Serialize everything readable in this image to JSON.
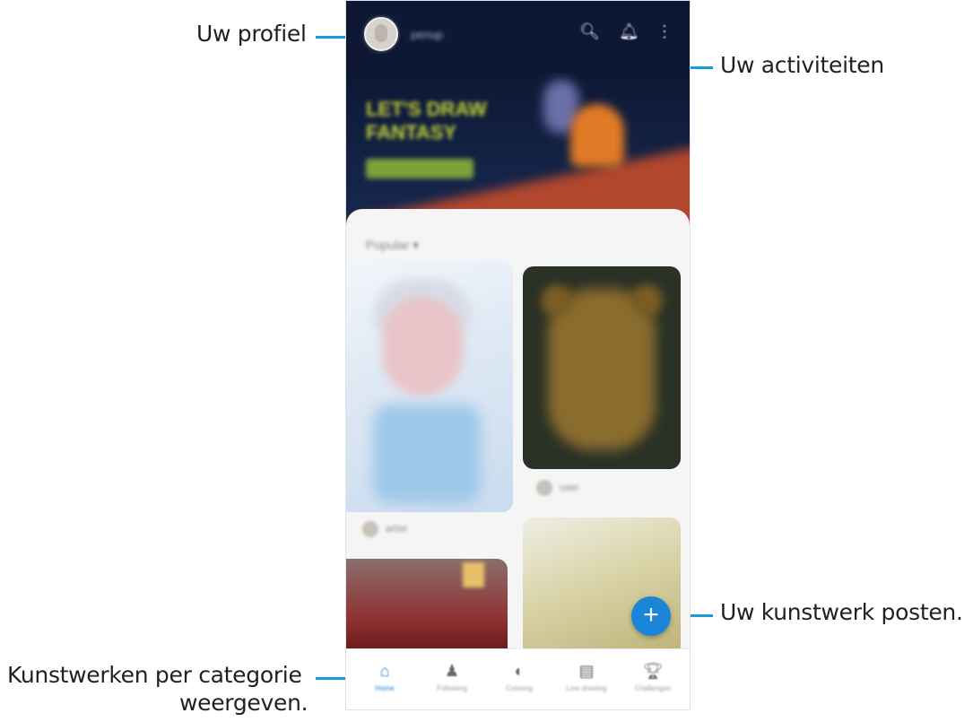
{
  "callouts": {
    "profile": "Uw profiel",
    "activities": "Uw activiteiten",
    "post_artwork": "Uw kunstwerk posten.",
    "categories_line1": "Kunstwerken per categorie",
    "categories_line2": "weergeven."
  },
  "app": {
    "username": "penup",
    "banner_title": "LET'S DRAW FANTASY",
    "sort_label": "Popular",
    "card1_user": "artist",
    "card2_user": "user"
  },
  "toolbar_icons": [
    "search-icon",
    "bell-icon",
    "more-icon"
  ],
  "fab_label": "+",
  "nav": [
    {
      "icon": "home-icon",
      "label": "Home"
    },
    {
      "icon": "following-icon",
      "label": "Following"
    },
    {
      "icon": "coloring-icon",
      "label": "Coloring"
    },
    {
      "icon": "live-drawing-icon",
      "label": "Live drawing"
    },
    {
      "icon": "challenges-icon",
      "label": "Challenges"
    }
  ],
  "colors": {
    "accent": "#1a9bd7",
    "fab": "#1b86d8",
    "topbar": "#0e1834"
  }
}
